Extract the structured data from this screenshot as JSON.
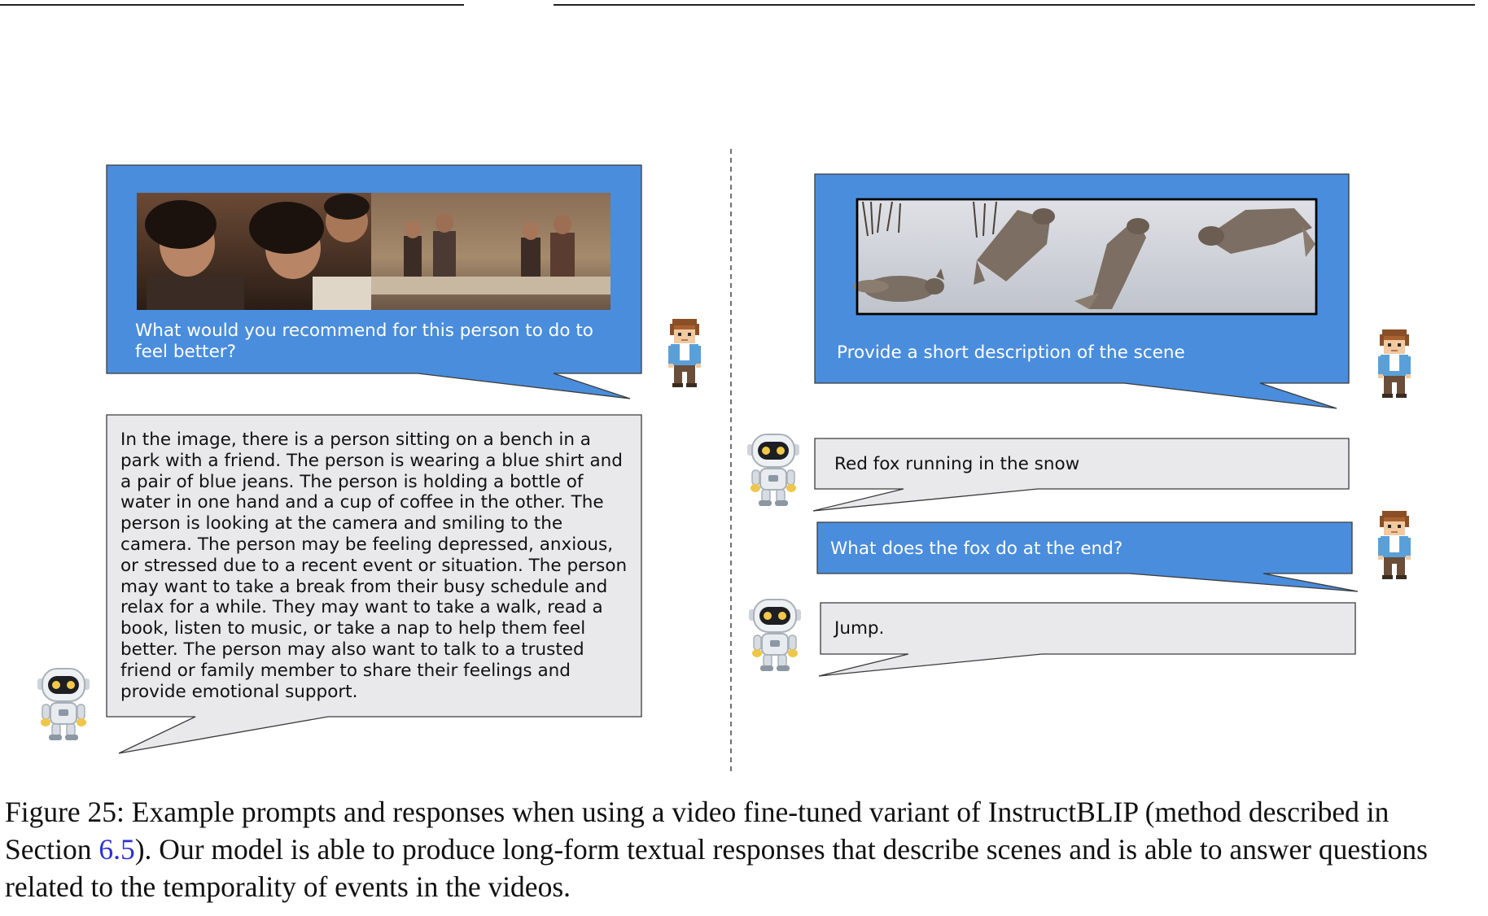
{
  "colors": {
    "prompt_bubble": "#4a8ddc",
    "response_bubble": "#e9e9eb",
    "link_ref": "#2b32d6"
  },
  "left_panel": {
    "prompt": "What would you recommend for this person to do to feel better?",
    "response": "In the image, there is a person sitting on a bench in a park with a friend. The person is wearing a blue shirt and a pair of blue jeans. The person is holding a bottle of water in one hand and a cup of coffee in the other. The person is looking at the camera and smiling to the camera. The person may be feeling depressed, anxious, or stressed due to a recent event or situation. The person may want to take a break from their busy schedule and relax for a while. They may want to take a walk, read a book, listen to music, or take a nap to help them feel better. The person may also want to talk to a trusted friend or family member to share their feelings and provide emotional support."
  },
  "right_panel": {
    "prompt_1": "Provide a short description of the scene",
    "response_1": "Red fox running in the snow",
    "prompt_2": "What does the fox do at the end?",
    "response_2": "Jump."
  },
  "caption": {
    "part1": "Figure 25: Example prompts and responses when using a video fine-tuned variant of InstructBLIP (method described in Section ",
    "ref": "6.5",
    "part2": "). Our model is able to produce long-form textual responses that describe scenes and is able to answer questions related to the temporality of events in the videos."
  },
  "icons": [
    "user-avatar-icon",
    "robot-avatar-icon"
  ]
}
